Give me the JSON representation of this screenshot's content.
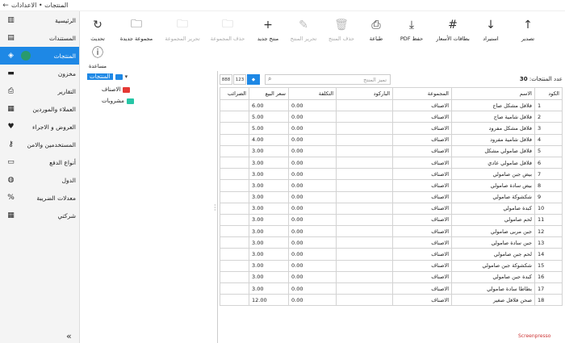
{
  "window": {
    "title": "المنتجات • الاعدادات",
    "back_icon": "arrow-left-icon"
  },
  "sidebar": {
    "items": [
      {
        "label": "الرئيسية",
        "icon": "chart-icon"
      },
      {
        "label": "المستندات",
        "icon": "document-icon"
      },
      {
        "label": "المنتجات",
        "icon": "tag-icon",
        "active": true
      },
      {
        "label": "مخزون",
        "icon": "box-icon"
      },
      {
        "label": "التقارير",
        "icon": "printer-icon"
      },
      {
        "label": "العملاء والموردين",
        "icon": "contacts-icon"
      },
      {
        "label": "العروض و الاجراء",
        "icon": "heart-icon"
      },
      {
        "label": "المستخدمين والامن",
        "icon": "key-icon"
      },
      {
        "label": "أنواع الدفع",
        "icon": "payment-icon"
      },
      {
        "label": "الدول",
        "icon": "globe-icon"
      },
      {
        "label": "معدلات الضريبة",
        "icon": "percent-icon"
      },
      {
        "label": "شركتي",
        "icon": "building-icon"
      }
    ],
    "collapse_glyph": "«"
  },
  "toolbar": {
    "refresh": "تحديث",
    "new_group": "مجموعة جديدة",
    "edit_group": "تحرير المجموعة",
    "delete_group": "حذف المجموعة",
    "new_product": "منتج جديد",
    "edit_product": "تحرير المنتج",
    "delete_product": "حذف المنتج",
    "print": "طباعة",
    "save_pdf": "حفظ PDF",
    "price_tags": "بطاقات الأسعار",
    "import": "استيراد",
    "export": "تصدير",
    "help": "مساعدة"
  },
  "tree": {
    "root": "المنتجات",
    "children": [
      {
        "label": "الاصناف",
        "color": "#e53935"
      },
      {
        "label": "مشروبات",
        "color": "#26c6a6"
      }
    ]
  },
  "grid": {
    "view_buttons": [
      "888",
      "123"
    ],
    "search_placeholder": "تميز المنتج",
    "count_label": "عدد المنتجات:",
    "count_value": "30",
    "columns": [
      "الكود",
      "الاسم",
      "المجموعة",
      "الباركود",
      "التكلفة",
      "سعر البيع",
      "الضرائب"
    ],
    "rows": [
      [
        "1",
        "فلافل مشكل صاج",
        "الاصناف",
        "",
        "0.00",
        "6.00",
        ""
      ],
      [
        "2",
        "فلافل شامية صاج",
        "الاصناف",
        "",
        "0.00",
        "5.00",
        ""
      ],
      [
        "3",
        "فلافل مشكل مفرود",
        "الاصناف",
        "",
        "0.00",
        "5.00",
        ""
      ],
      [
        "4",
        "فلافل شامية مفرود",
        "الاصناف",
        "",
        "0.00",
        "4.00",
        ""
      ],
      [
        "5",
        "فلافل صامولي مشكل",
        "الاصناف",
        "",
        "0.00",
        "3.00",
        ""
      ],
      [
        "6",
        "فلافل صامولي عادي",
        "الاصناف",
        "",
        "0.00",
        "3.00",
        ""
      ],
      [
        "7",
        "بيض جبن صامولي",
        "الاصناف",
        "",
        "0.00",
        "3.00",
        ""
      ],
      [
        "8",
        "بيض سادة صامولي",
        "الاصناف",
        "",
        "0.00",
        "3.00",
        ""
      ],
      [
        "9",
        "شكشوكة صامولي",
        "الاصناف",
        "",
        "0.00",
        "3.00",
        ""
      ],
      [
        "10",
        "كبدة صامولي",
        "الاصناف",
        "",
        "0.00",
        "3.00",
        ""
      ],
      [
        "11",
        "لحم صامولي",
        "الاصناف",
        "",
        "0.00",
        "3.00",
        ""
      ],
      [
        "12",
        "جبن مربى صامولي",
        "الاصناف",
        "",
        "0.00",
        "3.00",
        ""
      ],
      [
        "13",
        "جبن سادة صامولي",
        "الاصناف",
        "",
        "0.00",
        "3.00",
        ""
      ],
      [
        "14",
        "لحم جبن صامولي",
        "الاصناف",
        "",
        "0.00",
        "3.00",
        ""
      ],
      [
        "15",
        "شكشوكة جبن صامولي",
        "الاصناف",
        "",
        "0.00",
        "3.00",
        ""
      ],
      [
        "16",
        "كبدة جبن صامولي",
        "الاصناف",
        "",
        "0.00",
        "3.00",
        ""
      ],
      [
        "17",
        "بطاطا سادة صامولي",
        "الاصناف",
        "",
        "0.00",
        "3.00",
        ""
      ],
      [
        "18",
        "صحن فلافل صغير",
        "الاصناف",
        "",
        "0.00",
        "12.00",
        ""
      ]
    ]
  },
  "watermark": "Screenpresso"
}
